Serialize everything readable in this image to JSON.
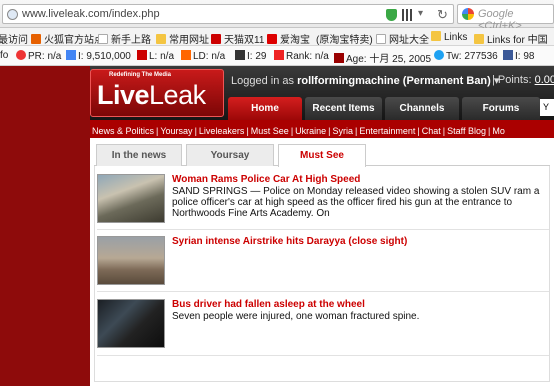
{
  "browser": {
    "url": "www.liveleak.com/index.php",
    "search_placeholder": "Google <Ctrl+K>"
  },
  "bookmarks": [
    "最访问",
    "火狐官方站点",
    "新手上路",
    "常用网址",
    "天猫双11",
    "爱淘宝",
    "(原淘宝特卖)",
    "网址大全",
    "Links",
    "Links for 中国"
  ],
  "seo": {
    "info": "fo",
    "pr": "PR: n/a",
    "indexed": "I: 9,510,000",
    "links": "L: n/a",
    "ld": "LD: n/a",
    "i2": "I: 29",
    "rank": "Rank: n/a",
    "age": "Age: 十月 25, 2005",
    "tw": "Tw: 277536",
    "fb": "I: 98"
  },
  "site": {
    "logo_tagline": "Redefining The Media",
    "logo_live": "Live",
    "logo_leak": "Leak",
    "logged_prefix": "Logged in as ",
    "username": "rollformingmachine (Permanent Ban)",
    "points_label": "| Points: ",
    "points_value": "0.00",
    "nav": [
      "Home",
      "Recent Items",
      "Channels",
      "Forums"
    ],
    "search_letter": "Y"
  },
  "subnav": [
    "News & Politics",
    "Yoursay",
    "Liveleakers",
    "Must See",
    "Ukraine",
    "Syria",
    "Entertainment",
    "Chat",
    "Staff Blog",
    "Mo"
  ],
  "content_tabs": [
    "In the news",
    "Yoursay",
    "Must See"
  ],
  "items": [
    {
      "title": "Woman Rams Police Car At High Speed",
      "desc": "SAND SPRINGS — Police on Monday released video showing a stolen SUV ram a police officer's car at high speed as the officer fired his gun at the entrance to Northwoods Fine Arts Academy. On"
    },
    {
      "title": "Syrian intense Airstrike hits Darayya (close sight)",
      "desc": ""
    },
    {
      "title": "Bus driver had fallen asleep at the wheel",
      "desc": "Seven people were injured, one woman fractured spine."
    }
  ]
}
